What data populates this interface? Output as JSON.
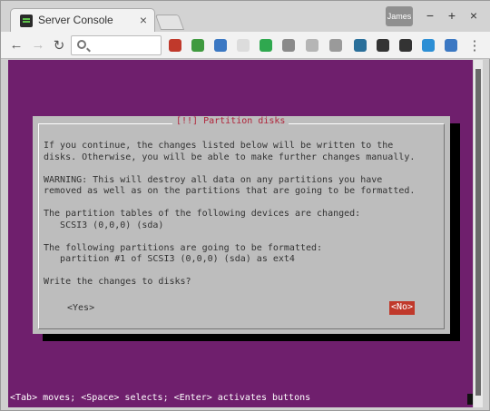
{
  "browser": {
    "tab_title": "Server Console",
    "tab_close": "×",
    "profile_label": "James",
    "window_controls": {
      "minimize": "−",
      "maximize": "+",
      "close": "×"
    },
    "nav": {
      "back": "←",
      "forward": "→",
      "reload": "↻"
    },
    "omnibox_value": "",
    "extensions": [
      {
        "name": "ublock-icon",
        "color": "#c0392b"
      },
      {
        "name": "extension-green-icon",
        "color": "#3f9a3f"
      },
      {
        "name": "layers-icon",
        "color": "#3b78c3"
      },
      {
        "name": "faded-extension-icon",
        "color": "#dcdcdc"
      },
      {
        "name": "checkmark-icon",
        "color": "#2fa84f"
      },
      {
        "name": "clock-icon",
        "color": "#8a8a8a"
      },
      {
        "name": "document-icon",
        "color": "#b5b5b5"
      },
      {
        "name": "bookmark-icon",
        "color": "#9a9a9a"
      },
      {
        "name": "cloud-badge-icon",
        "color": "#2a6f9a"
      },
      {
        "name": "camera-icon",
        "color": "#333333"
      },
      {
        "name": "archive-icon",
        "color": "#333333"
      },
      {
        "name": "s-logo-icon",
        "color": "#2d8fd5"
      },
      {
        "name": "plane-icon",
        "color": "#3b78c3"
      }
    ],
    "menu_icon": "⋮"
  },
  "installer": {
    "dialog_title": "[!!] Partition disks",
    "body_lines": [
      "If you continue, the changes listed below will be written to the",
      "disks. Otherwise, you will be able to make further changes manually.",
      "",
      "WARNING: This will destroy all data on any partitions you have",
      "removed as well as on the partitions that are going to be formatted.",
      "",
      "The partition tables of the following devices are changed:",
      "   SCSI3 (0,0,0) (sda)",
      "",
      "The following partitions are going to be formatted:",
      "   partition #1 of SCSI3 (0,0,0) (sda) as ext4",
      "",
      "Write the changes to disks?"
    ],
    "yes_label": "<Yes>",
    "no_label": "<No>",
    "status_line": "<Tab> moves; <Space> selects; <Enter> activates buttons"
  },
  "colors": {
    "background_purple": "#6f1f6d",
    "dialog_gray": "#bdbdbd",
    "title_red": "#b0243a",
    "selected_button": "#c0392b"
  }
}
